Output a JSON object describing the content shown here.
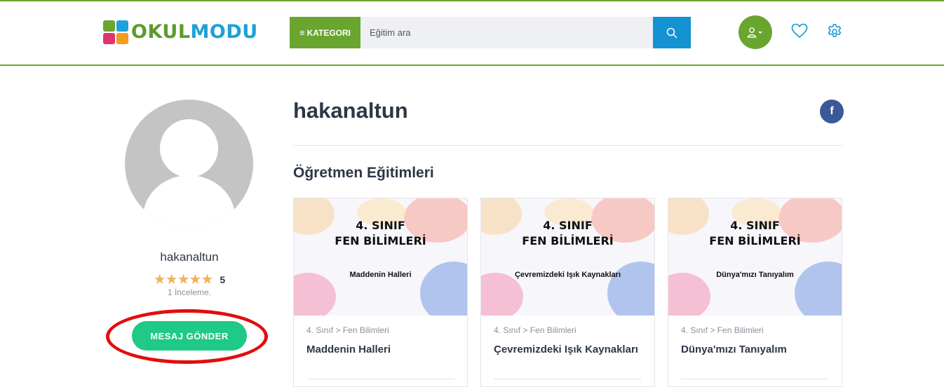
{
  "header": {
    "logo_okul": "OKUL",
    "logo_modu": "MODU",
    "category_label": "KATEGORI",
    "search_placeholder": "Eğitim ara"
  },
  "icons": {
    "search": "search-icon",
    "user": "user-icon",
    "heart": "heart-icon",
    "gear": "gear-icon",
    "facebook": "facebook-icon"
  },
  "colors": {
    "brand_green": "#6aa52f",
    "search_blue": "#1592d1",
    "message_button": "#1fc986",
    "highlight_ring": "#e20d0d",
    "facebook": "#3b5998",
    "star": "#f2b15a"
  },
  "profile": {
    "username": "hakanaltun",
    "title": "hakanaltun",
    "rating": "5",
    "stars_filled": 5,
    "review_count": "1 İnceleme.",
    "message_button": "MESAJ GÖNDER",
    "facebook_glyph": "f"
  },
  "section": {
    "title": "Öğretmen Eğitimleri"
  },
  "courses": [
    {
      "grade_line1": "4. SINIF",
      "grade_line2": "FEN BİLİMLERİ",
      "lesson": "Maddenin Halleri",
      "category": "4. Sınıf > Fen Bilimleri",
      "title": "Maddenin Halleri"
    },
    {
      "grade_line1": "4. SINIF",
      "grade_line2": "FEN BİLİMLERİ",
      "lesson": "Çevremizdeki Işık Kaynakları",
      "category": "4. Sınıf > Fen Bilimleri",
      "title": "Çevremizdeki Işık Kaynakları"
    },
    {
      "grade_line1": "4. SINIF",
      "grade_line2": "FEN BİLİMLERİ",
      "lesson": "Dünya'mızı Tanıyalım",
      "category": "4. Sınıf > Fen Bilimleri",
      "title": "Dünya'mızı Tanıyalım"
    }
  ]
}
